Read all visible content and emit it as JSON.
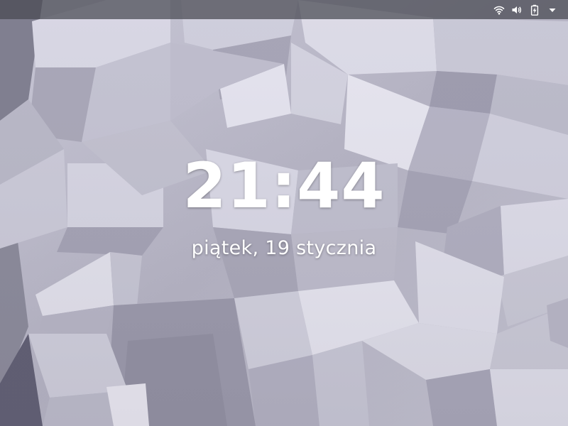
{
  "lock_screen": {
    "time": "21:44",
    "date": "piątek, 19 stycznia"
  },
  "top_bar": {
    "status_icons": [
      "wifi-icon",
      "volume-icon",
      "battery-charging-icon",
      "system-menu-arrow-icon"
    ]
  },
  "colors": {
    "top_bar_bg": "#464850",
    "text": "#ffffff",
    "wallpaper_base": "#b9b8c8"
  }
}
